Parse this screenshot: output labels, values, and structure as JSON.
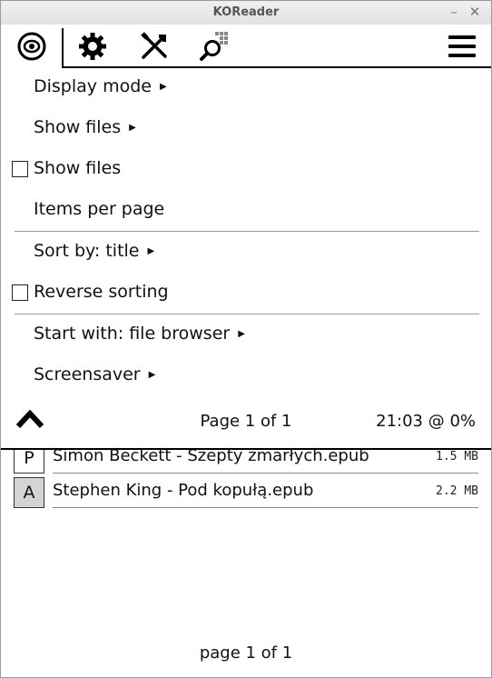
{
  "window": {
    "title": "KOReader",
    "minimize_glyph": "–",
    "close_glyph": "✕"
  },
  "tabs": [
    {
      "icon": "filemanager-icon"
    },
    {
      "icon": "gear-icon"
    },
    {
      "icon": "tools-icon"
    },
    {
      "icon": "search-icon"
    },
    {
      "icon": "hamburger-menu-icon"
    }
  ],
  "menu": {
    "items": [
      {
        "label": "Display mode",
        "submenu": true
      },
      {
        "label": "Show files",
        "submenu": true
      },
      {
        "label": "Show files",
        "checked": false
      },
      {
        "label": "Items per page"
      },
      {
        "label": "Sort by: title",
        "submenu": true
      },
      {
        "label": "Reverse sorting",
        "checked": false
      },
      {
        "label": "Start with: file browser",
        "submenu": true
      },
      {
        "label": "Screensaver",
        "submenu": true
      }
    ],
    "submenu_arrow": "▶",
    "footer": {
      "page_info": "Page 1 of 1",
      "clock": "21:03 @ 0%"
    }
  },
  "file_browser": {
    "files": [
      {
        "letter": "P",
        "name": "Simon Beckett - Szepty zmarłych.epub",
        "size": "1.5 MB"
      },
      {
        "letter": "A",
        "name": "Stephen King - Pod kopułą.epub",
        "size": "2.2 MB"
      }
    ],
    "footer_page_info": "page 1 of 1"
  }
}
